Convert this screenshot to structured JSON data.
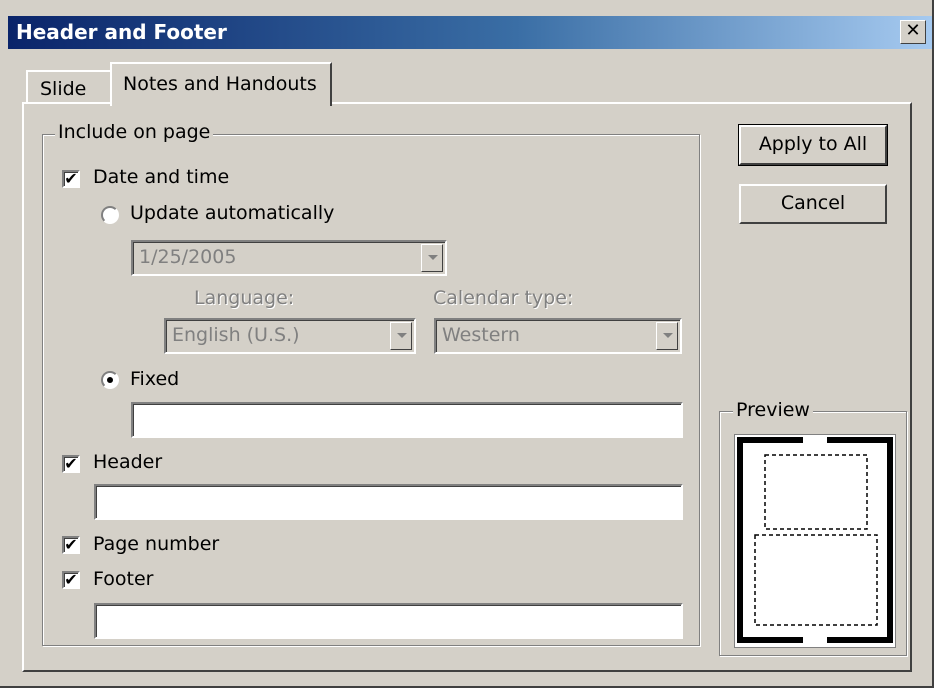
{
  "window": {
    "title": "Header and Footer",
    "close_glyph": "✕"
  },
  "tabs": [
    {
      "label": "Slide",
      "active": false
    },
    {
      "label": "Notes and Handouts",
      "active": true
    }
  ],
  "include": {
    "group_label": "Include on page",
    "date_time": {
      "label": "Date and time",
      "checked": true,
      "update_auto_label": "Update automatically",
      "date_value": "1/25/2005",
      "language_label": "Language:",
      "language_value": "English (U.S.)",
      "calendar_label": "Calendar type:",
      "calendar_value": "Western",
      "fixed_label": "Fixed",
      "fixed_selected": true,
      "fixed_value": ""
    },
    "header": {
      "label": "Header",
      "checked": true,
      "value": ""
    },
    "page_number": {
      "label": "Page number",
      "checked": true
    },
    "footer": {
      "label": "Footer",
      "checked": true,
      "value": ""
    }
  },
  "buttons": {
    "apply_all": "Apply to All",
    "cancel": "Cancel"
  },
  "preview": {
    "label": "Preview"
  },
  "icons": {
    "check": "✔",
    "close": "close-icon",
    "dropdown": "chevron-down-icon"
  },
  "colors": {
    "title_start": "#0a246a",
    "title_end": "#a6caf0",
    "face": "#d4d0c8"
  }
}
